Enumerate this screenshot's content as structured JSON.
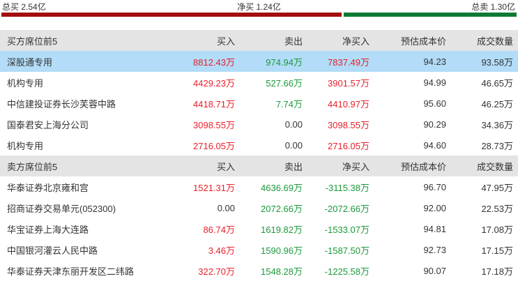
{
  "summary": {
    "total_buy_label": "总买 2.54亿",
    "net_buy_label": "净买 1.24亿",
    "total_sell_label": "总卖 1.30亿",
    "buy_share": 0.661
  },
  "colors": {
    "up": "#e8202a",
    "down": "#1a9a3a",
    "buy_bar": "#a30e0e",
    "sell_bar": "#0d7a33",
    "highlight": "#b2dcf7",
    "header_bg": "#e4e4e4"
  },
  "buyers": {
    "header": [
      "买方席位前5",
      "买入",
      "卖出",
      "净买入",
      "预估成本价",
      "成交数量"
    ],
    "rows": [
      {
        "name": "深股通专用",
        "buy": "8812.43万",
        "buy_color": "red",
        "sell": "974.94万",
        "sell_color": "green",
        "net": "7837.49万",
        "net_color": "red",
        "cost": "94.23",
        "volume": "93.58万",
        "highlight": true
      },
      {
        "name": "机构专用",
        "buy": "4429.23万",
        "buy_color": "red",
        "sell": "527.66万",
        "sell_color": "green",
        "net": "3901.57万",
        "net_color": "red",
        "cost": "94.99",
        "volume": "46.65万",
        "highlight": false
      },
      {
        "name": "中信建投证券长沙芙蓉中路",
        "buy": "4418.71万",
        "buy_color": "red",
        "sell": "7.74万",
        "sell_color": "green",
        "net": "4410.97万",
        "net_color": "red",
        "cost": "95.60",
        "volume": "46.25万",
        "highlight": false
      },
      {
        "name": "国泰君安上海分公司",
        "buy": "3098.55万",
        "buy_color": "red",
        "sell": "0.00",
        "sell_color": "dark",
        "net": "3098.55万",
        "net_color": "red",
        "cost": "90.29",
        "volume": "34.36万",
        "highlight": false
      },
      {
        "name": "机构专用",
        "buy": "2716.05万",
        "buy_color": "red",
        "sell": "0.00",
        "sell_color": "dark",
        "net": "2716.05万",
        "net_color": "red",
        "cost": "94.60",
        "volume": "28.73万",
        "highlight": false
      }
    ]
  },
  "sellers": {
    "header": [
      "卖方席位前5",
      "买入",
      "卖出",
      "净买入",
      "预估成本价",
      "成交数量"
    ],
    "rows": [
      {
        "name": "华泰证券北京雍和宫",
        "buy": "1521.31万",
        "buy_color": "red",
        "sell": "4636.69万",
        "sell_color": "green",
        "net": "-3115.38万",
        "net_color": "green",
        "cost": "96.70",
        "volume": "47.95万",
        "highlight": false
      },
      {
        "name": "招商证券交易单元(052300)",
        "buy": "0.00",
        "buy_color": "dark",
        "sell": "2072.66万",
        "sell_color": "green",
        "net": "-2072.66万",
        "net_color": "green",
        "cost": "92.00",
        "volume": "22.53万",
        "highlight": false
      },
      {
        "name": "华宝证券上海大连路",
        "buy": "86.74万",
        "buy_color": "red",
        "sell": "1619.82万",
        "sell_color": "green",
        "net": "-1533.07万",
        "net_color": "green",
        "cost": "94.81",
        "volume": "17.08万",
        "highlight": false
      },
      {
        "name": "中国银河灌云人民中路",
        "buy": "3.46万",
        "buy_color": "red",
        "sell": "1590.96万",
        "sell_color": "green",
        "net": "-1587.50万",
        "net_color": "green",
        "cost": "92.73",
        "volume": "17.15万",
        "highlight": false
      },
      {
        "name": "华泰证券天津东丽开发区二纬路",
        "buy": "322.70万",
        "buy_color": "red",
        "sell": "1548.28万",
        "sell_color": "green",
        "net": "-1225.58万",
        "net_color": "green",
        "cost": "90.07",
        "volume": "17.18万",
        "highlight": false
      }
    ]
  }
}
